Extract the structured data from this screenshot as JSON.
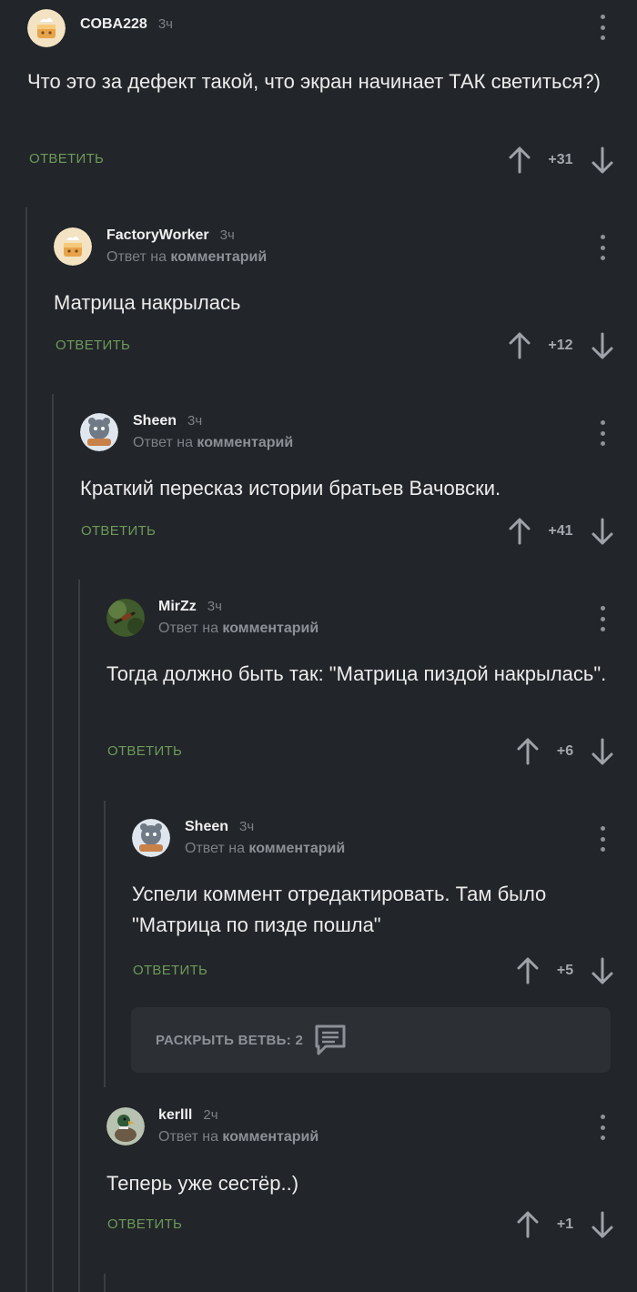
{
  "common": {
    "reply_label": "ОТВЕТИТЬ",
    "reply_to_prefix": "Ответ на",
    "reply_to_link": "комментарий"
  },
  "comments": [
    {
      "author": "COBA228",
      "time": "3ч",
      "text": "Что это за дефект такой, что экран начинает ТАК светиться?)",
      "score": "+31",
      "is_reply": false,
      "avatar": "cake-avatar"
    },
    {
      "author": "FactoryWorker",
      "time": "3ч",
      "text": "Матрица накрылась",
      "score": "+12",
      "is_reply": true,
      "avatar": "cake-avatar"
    },
    {
      "author": "Sheen",
      "time": "3ч",
      "text": "Краткий пересказ истории братьев Вачовски.",
      "score": "+41",
      "is_reply": true,
      "avatar": "cat-avatar"
    },
    {
      "author": "MirZz",
      "time": "3ч",
      "text": "Тогда должно быть так: \"Матрица пиздой накрылась\".",
      "score": "+6",
      "is_reply": true,
      "avatar": "insect-avatar"
    },
    {
      "author": "Sheen",
      "time": "3ч",
      "text": "Успели коммент отредактировать. Там было \"Матрица по пизде пошла\"",
      "score": "+5",
      "is_reply": true,
      "avatar": "cat-avatar"
    },
    {
      "author": "kerlll",
      "time": "2ч",
      "text": "Теперь уже сестёр..)",
      "score": "+1",
      "is_reply": true,
      "avatar": "duck-avatar"
    }
  ],
  "expand_branch": {
    "label": "РАСКРЫТЬ ВЕТВЬ: 2",
    "icon": "comment-icon"
  },
  "colors": {
    "background": "#222529",
    "reply_button": "#6d9a5a",
    "muted": "#7d8187"
  }
}
